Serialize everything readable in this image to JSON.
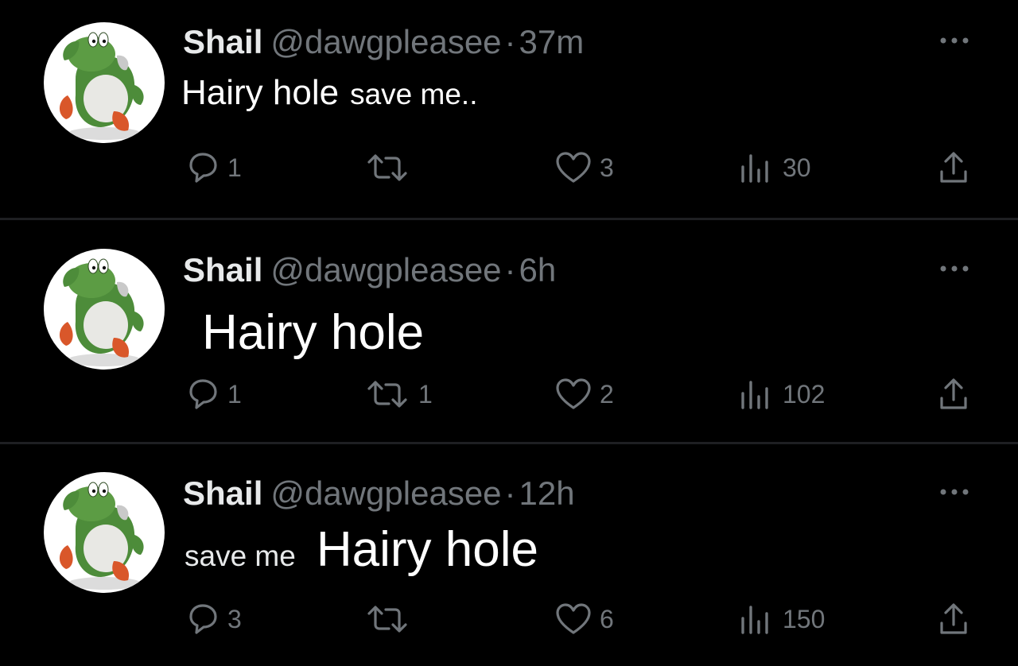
{
  "tweets": [
    {
      "author": "Shail",
      "handle": "@dawgpleasee",
      "separator": "·",
      "time": "37m",
      "text_large": "Hairy hole",
      "text_small": "save me..",
      "replies": "1",
      "retweets": "",
      "likes": "3",
      "views": "30"
    },
    {
      "author": "Shail",
      "handle": "@dawgpleasee",
      "separator": "·",
      "time": "6h",
      "text_large": "Hairy hole",
      "replies": "1",
      "retweets": "1",
      "likes": "2",
      "views": "102"
    },
    {
      "author": "Shail",
      "handle": "@dawgpleasee",
      "separator": "·",
      "time": "12h",
      "text_small": "save me",
      "text_large": "Hairy hole",
      "replies": "3",
      "retweets": "",
      "likes": "6",
      "views": "150"
    }
  ],
  "icons": {
    "reply": "reply-icon",
    "retweet": "retweet-icon",
    "like": "heart-icon",
    "views": "views-icon",
    "share": "share-icon",
    "more": "more-icon",
    "avatar": "yoshi-avatar"
  },
  "colors": {
    "background": "#000000",
    "muted_text": "#71767b",
    "primary_text": "#e7e9ea",
    "divider": "#1e1f22"
  }
}
